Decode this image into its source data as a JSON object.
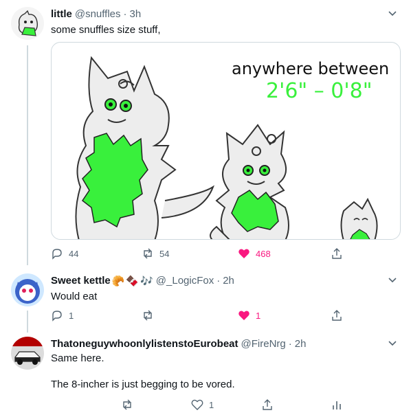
{
  "tweets": [
    {
      "name": "little",
      "handle": "@snuffles",
      "time": "3h",
      "text": "some snuffles size stuff,",
      "media_text": {
        "line1": "anywhere between",
        "line2": "2'6\" – 0'8\""
      },
      "actions": {
        "reply": "44",
        "retweet": "54",
        "like": "468"
      }
    },
    {
      "name": "Sweet kettle",
      "name_emojis": [
        "🥐",
        "🍫",
        "🎶"
      ],
      "handle": "@_LogicFox",
      "time": "2h",
      "text": "Would eat",
      "actions": {
        "reply": "1",
        "retweet": "",
        "like": "1"
      }
    },
    {
      "name": "ThatoneguywhoonlylistenstoEurobeat",
      "handle": "@FireNrg",
      "time": "2h",
      "text_lines": [
        "Same here.",
        "The 8-incher is just begging to be vored."
      ],
      "actions": {
        "reply": "",
        "retweet": "",
        "like": "1"
      }
    }
  ],
  "colors": {
    "accent_green": "#39f03c",
    "like_pink": "#f91880",
    "muted": "#536471"
  }
}
